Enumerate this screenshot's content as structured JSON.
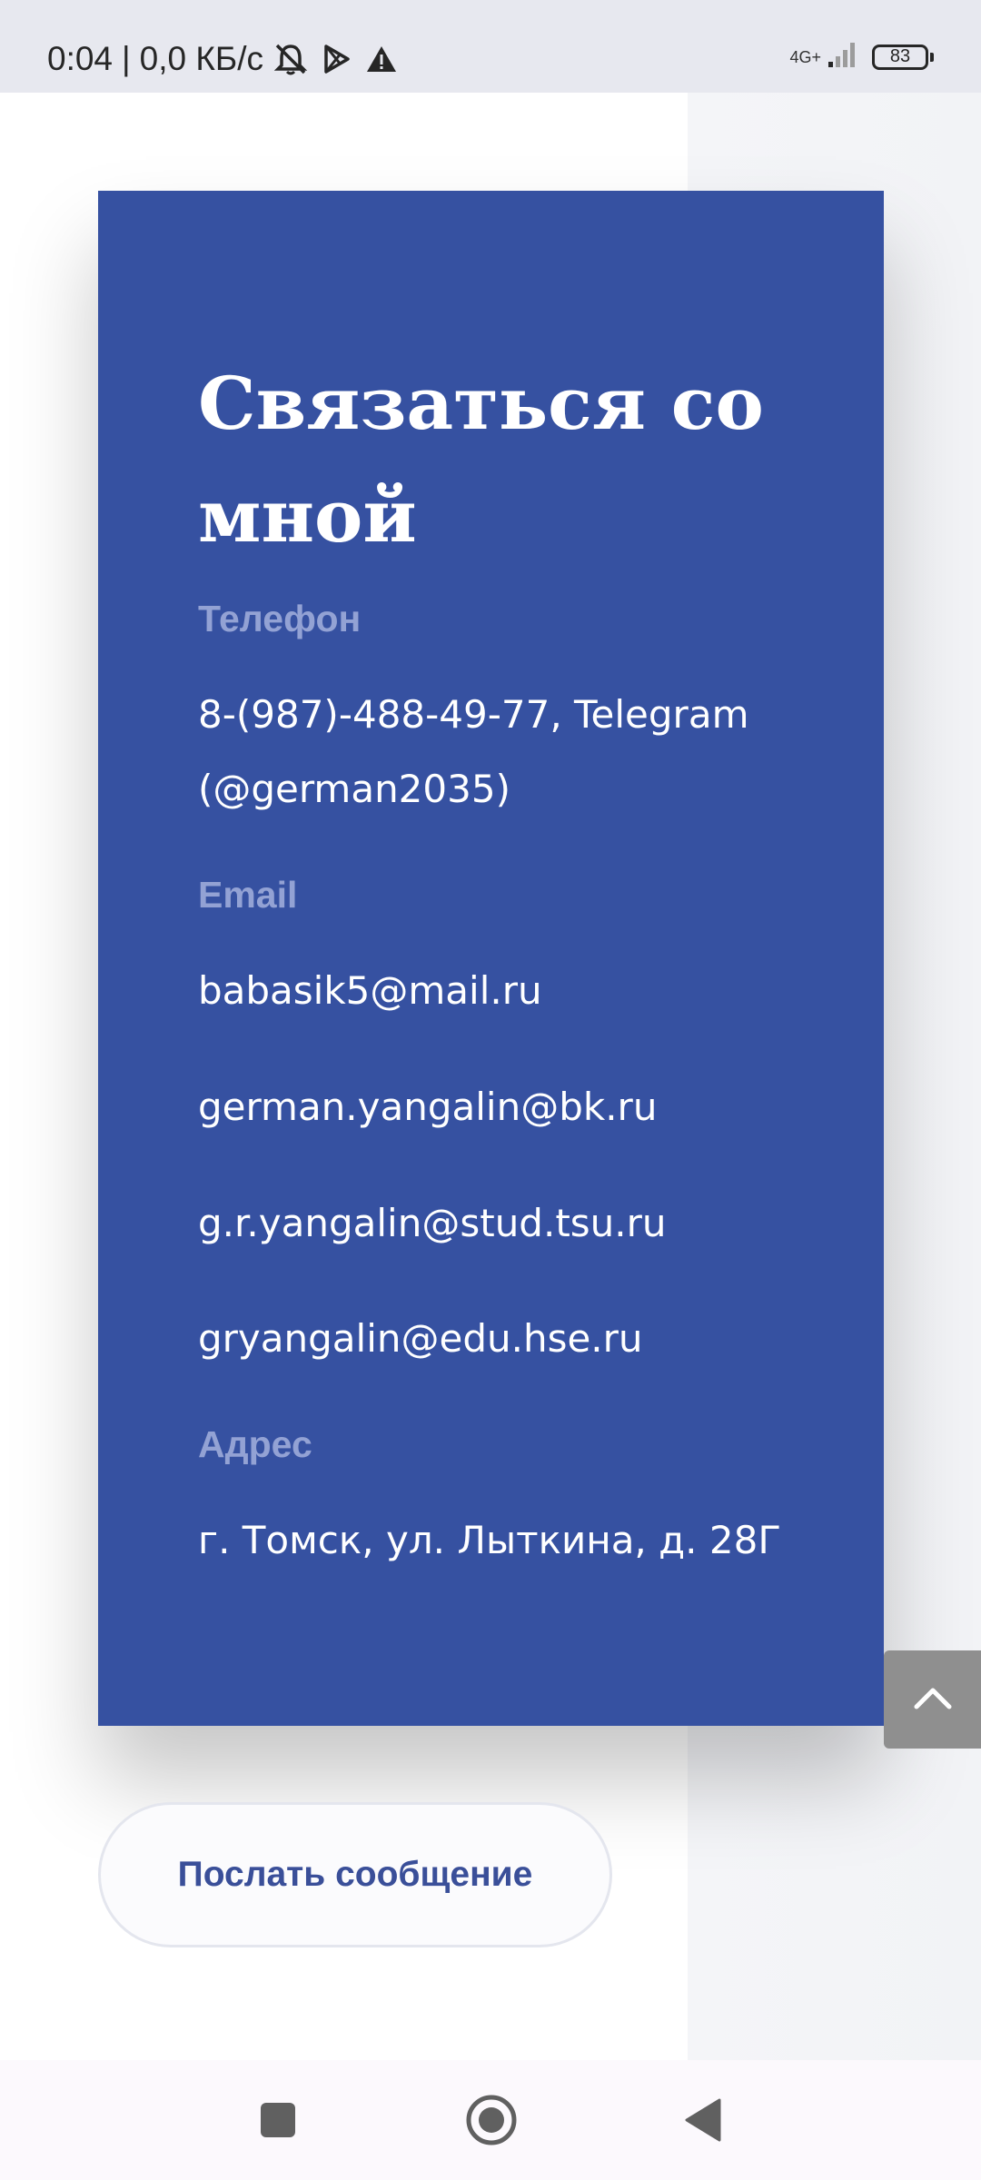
{
  "status_bar": {
    "time": "0:04",
    "separator": "|",
    "speed": "0,0 КБ/с",
    "network_type": "4G+",
    "battery_level": "83",
    "icons": [
      "mute-notifications-icon",
      "play-store-icon",
      "warning-icon",
      "signal-icon",
      "battery-icon"
    ]
  },
  "contact": {
    "title": "Связаться со мной",
    "phone_label": "Телефон",
    "phone_value": "8-(987)-488-49-77, Telegram (@german2035)",
    "email_label": "Email",
    "emails": [
      "babasik5@mail.ru",
      "german.yangalin@bk.ru",
      "g.r.yangalin@stud.tsu.ru",
      "gryangalin@edu.hse.ru"
    ],
    "address_label": "Адрес",
    "address_value": "г. Томск, ул. Лыткина, д. 28Г"
  },
  "send_button_label": "Послать сообщение",
  "colors": {
    "card_background": "#3651a1",
    "label_color": "#93a2d4",
    "button_text": "#3a4f99",
    "scroll_top_button": "#8f8f8f"
  },
  "nav_bar": {
    "icons": [
      "recent-apps-icon",
      "home-icon",
      "back-icon"
    ]
  }
}
